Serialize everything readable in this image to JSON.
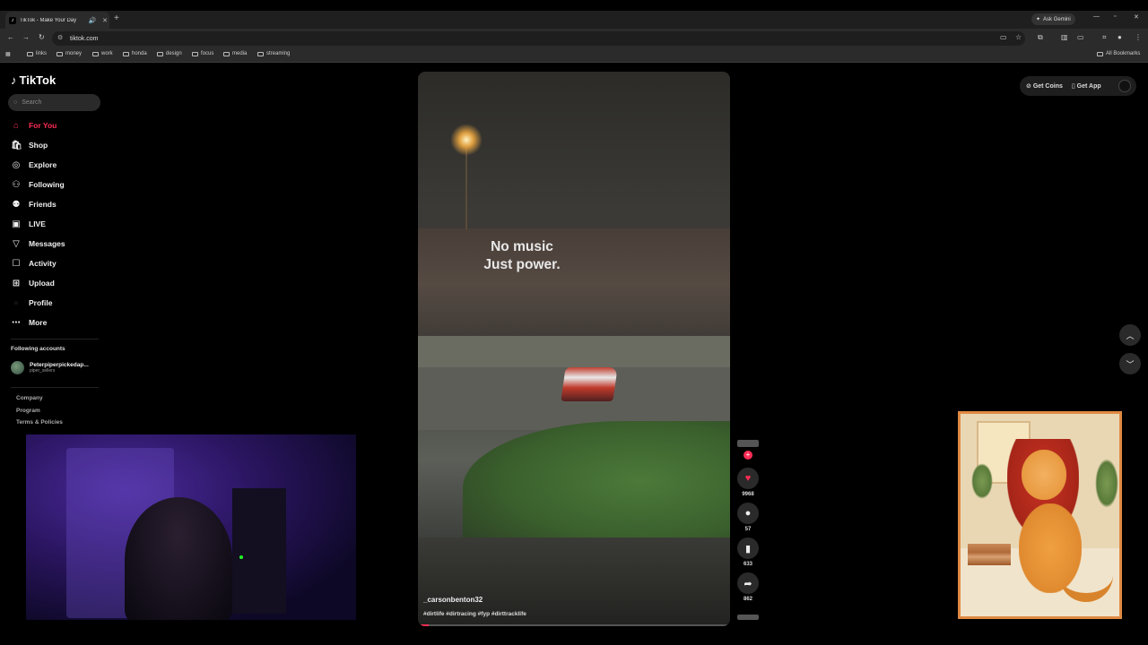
{
  "browser": {
    "tab_title": "TikTok - Make Your Day",
    "url": "tiktok.com",
    "ask_gemini": "Ask Gemini",
    "bookmarks": [
      "links",
      "money",
      "work",
      "honda",
      "design",
      "focus",
      "media",
      "streaming"
    ],
    "all_bookmarks": "All Bookmarks"
  },
  "sidebar": {
    "logo": "TikTok",
    "search_placeholder": "Search",
    "items": [
      {
        "label": "For You",
        "icon": "home-icon"
      },
      {
        "label": "Shop",
        "icon": "shop-icon"
      },
      {
        "label": "Explore",
        "icon": "compass-icon"
      },
      {
        "label": "Following",
        "icon": "following-icon"
      },
      {
        "label": "Friends",
        "icon": "friends-icon"
      },
      {
        "label": "LIVE",
        "icon": "live-icon"
      },
      {
        "label": "Messages",
        "icon": "messages-icon"
      },
      {
        "label": "Activity",
        "icon": "activity-icon"
      },
      {
        "label": "Upload",
        "icon": "upload-icon"
      },
      {
        "label": "Profile",
        "icon": "profile-icon"
      },
      {
        "label": "More",
        "icon": "more-icon"
      }
    ],
    "following_label": "Following accounts",
    "account": {
      "name": "Peterpiperpickedap...",
      "handle": "piper_sellers"
    },
    "footer": [
      "Company",
      "Program",
      "Terms & Policies"
    ]
  },
  "video": {
    "overlay_text_line1": "No music",
    "overlay_text_line2": "Just power.",
    "username": "_carsonbenton32",
    "hashtags": "#dirtlife #dirtracing #fyp #dirttracklife"
  },
  "actions": {
    "likes": "9968",
    "comments": "57",
    "saves": "633",
    "shares": "862"
  },
  "topright": {
    "get_coins": "Get Coins",
    "get_app": "Get App"
  },
  "colors": {
    "accent": "#fe2c55"
  }
}
